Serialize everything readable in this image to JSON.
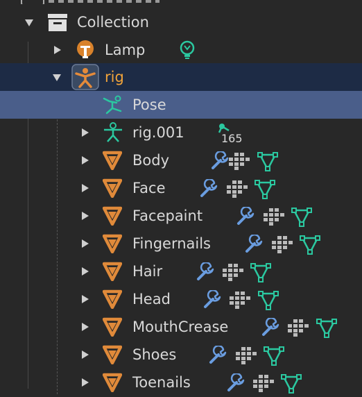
{
  "outliner": {
    "collection_label": "Collection",
    "lamp_label": "Lamp",
    "rig_label": "rig",
    "pose_label": "Pose",
    "rig001_label": "rig.001",
    "rig001_count": "165",
    "meshes": [
      "Body",
      "Face",
      "Facepaint",
      "Fingernails",
      "Hair",
      "Head",
      "MouthCrease",
      "Shoes",
      "Toenails"
    ]
  },
  "colors": {
    "mesh_orange": "#e08a3a",
    "modifier_blue": "#6a9de0",
    "vertex_green": "#2bc8a0",
    "selected_row": "#4a5e8a",
    "parent_row": "#1d2b45"
  },
  "icons": [
    "collection-icon",
    "lamp-icon",
    "light-data-icon",
    "armature-icon",
    "pose-icon",
    "bone-icon",
    "mesh-icon",
    "wrench-icon",
    "grid-icon",
    "vertex-group-icon"
  ]
}
